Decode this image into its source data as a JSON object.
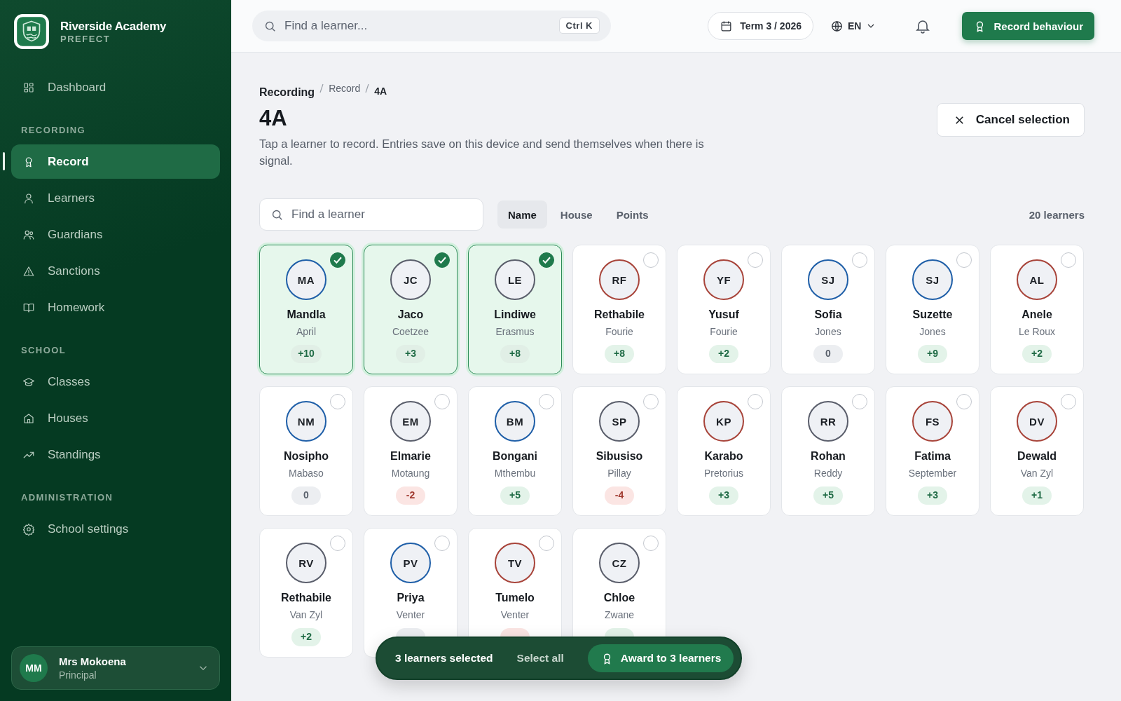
{
  "brand": {
    "name": "Riverside Academy",
    "role": "PREFECT"
  },
  "sidebar": {
    "sections": [
      {
        "items": [
          {
            "label": "Dashboard",
            "selected": false
          }
        ]
      },
      {
        "heading": "RECORDING",
        "items": [
          {
            "label": "Record",
            "selected": true
          },
          {
            "label": "Learners",
            "selected": false
          },
          {
            "label": "Guardians",
            "selected": false
          },
          {
            "label": "Sanctions",
            "selected": false
          },
          {
            "label": "Homework",
            "selected": false
          }
        ]
      },
      {
        "heading": "SCHOOL",
        "items": [
          {
            "label": "Classes",
            "selected": false
          },
          {
            "label": "Houses",
            "selected": false
          },
          {
            "label": "Standings",
            "selected": false
          }
        ]
      },
      {
        "heading": "ADMINISTRATION",
        "items": [
          {
            "label": "School settings",
            "selected": false
          }
        ]
      }
    ],
    "user": {
      "initials": "MM",
      "name": "Mrs Mokoena",
      "role": "Principal"
    }
  },
  "topbar": {
    "search": {
      "placeholder": "Find a learner...",
      "shortcut": "Ctrl K"
    },
    "term": "Term 3 / 2026",
    "language": "EN",
    "action": "Record behaviour"
  },
  "breadcrumb": [
    "Recording",
    "Record",
    "4A"
  ],
  "title": "4A",
  "description": "Tap a learner to record. Entries save on this device and send themselves when there is signal.",
  "cancel": "Cancel selection",
  "filter": {
    "placeholder": "Find a learner"
  },
  "sort_tabs": [
    {
      "label": "Name",
      "selected": true
    },
    {
      "label": "House",
      "selected": false
    },
    {
      "label": "Points",
      "selected": false
    }
  ],
  "count": "20 learners",
  "learners": [
    {
      "initials": "MA",
      "first": "Mandla",
      "last": "April",
      "points": "+10",
      "kind": "positive",
      "color": "#1f5fa8",
      "selected": true
    },
    {
      "initials": "JC",
      "first": "Jaco",
      "last": "Coetzee",
      "points": "+3",
      "kind": "positive",
      "color": "#5a5e6b",
      "selected": true
    },
    {
      "initials": "LE",
      "first": "Lindiwe",
      "last": "Erasmus",
      "points": "+8",
      "kind": "positive",
      "color": "#5a5e6b",
      "selected": true
    },
    {
      "initials": "RF",
      "first": "Rethabile",
      "last": "Fourie",
      "points": "+8",
      "kind": "positive",
      "color": "#a8443a",
      "selected": false
    },
    {
      "initials": "YF",
      "first": "Yusuf",
      "last": "Fourie",
      "points": "+2",
      "kind": "positive",
      "color": "#a8443a",
      "selected": false
    },
    {
      "initials": "SJ",
      "first": "Sofia",
      "last": "Jones",
      "points": "0",
      "kind": "neutral",
      "color": "#1f5fa8",
      "selected": false
    },
    {
      "initials": "SJ",
      "first": "Suzette",
      "last": "Jones",
      "points": "+9",
      "kind": "positive",
      "color": "#1f5fa8",
      "selected": false
    },
    {
      "initials": "AL",
      "first": "Anele",
      "last": "Le Roux",
      "points": "+2",
      "kind": "positive",
      "color": "#a8443a",
      "selected": false
    },
    {
      "initials": "NM",
      "first": "Nosipho",
      "last": "Mabaso",
      "points": "0",
      "kind": "neutral",
      "color": "#1f5fa8",
      "selected": false
    },
    {
      "initials": "EM",
      "first": "Elmarie",
      "last": "Motaung",
      "points": "-2",
      "kind": "negative",
      "color": "#5a5e6b",
      "selected": false
    },
    {
      "initials": "BM",
      "first": "Bongani",
      "last": "Mthembu",
      "points": "+5",
      "kind": "positive",
      "color": "#1f5fa8",
      "selected": false
    },
    {
      "initials": "SP",
      "first": "Sibusiso",
      "last": "Pillay",
      "points": "-4",
      "kind": "negative",
      "color": "#5a5e6b",
      "selected": false
    },
    {
      "initials": "KP",
      "first": "Karabo",
      "last": "Pretorius",
      "points": "+3",
      "kind": "positive",
      "color": "#a8443a",
      "selected": false
    },
    {
      "initials": "RR",
      "first": "Rohan",
      "last": "Reddy",
      "points": "+5",
      "kind": "positive",
      "color": "#5a5e6b",
      "selected": false
    },
    {
      "initials": "FS",
      "first": "Fatima",
      "last": "September",
      "points": "+3",
      "kind": "positive",
      "color": "#a8443a",
      "selected": false
    },
    {
      "initials": "DV",
      "first": "Dewald",
      "last": "Van Zyl",
      "points": "+1",
      "kind": "positive",
      "color": "#a8443a",
      "selected": false
    },
    {
      "initials": "RV",
      "first": "Rethabile",
      "last": "Van Zyl",
      "points": "+2",
      "kind": "positive",
      "color": "#5a5e6b",
      "selected": false
    },
    {
      "initials": "PV",
      "first": "Priya",
      "last": "Venter",
      "kind": "neutral",
      "color": "#1f5fa8",
      "selected": false
    },
    {
      "initials": "TV",
      "first": "Tumelo",
      "last": "Venter",
      "kind": "negative",
      "color": "#a8443a",
      "selected": false
    },
    {
      "initials": "CZ",
      "first": "Chloe",
      "last": "Zwane",
      "kind": "positive",
      "color": "#5a5e6b",
      "selected": false
    }
  ],
  "selection_bar": {
    "summary": "3 learners selected",
    "select_all": "Select all",
    "award": "Award to 3 learners"
  }
}
